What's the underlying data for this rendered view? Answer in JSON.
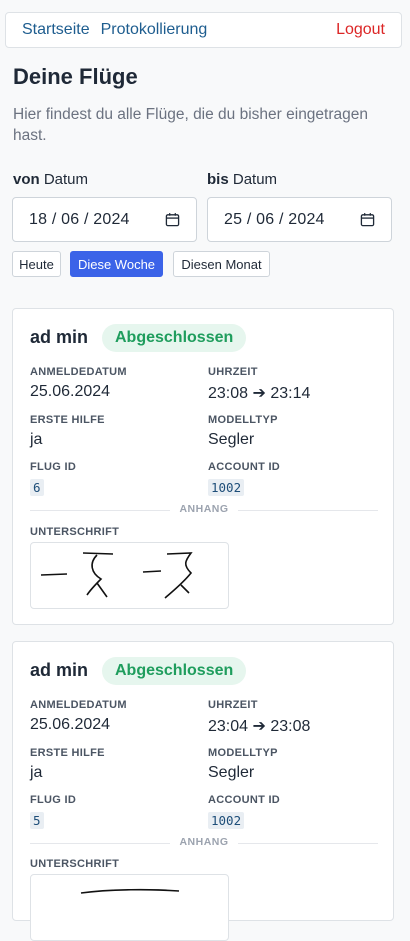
{
  "nav": {
    "home": "Startseite",
    "logging": "Protokollierung",
    "logout": "Logout"
  },
  "page": {
    "title": "Deine Flüge",
    "lead": "Hier findest du alle Flüge, die du bisher eingetragen hast."
  },
  "filter": {
    "from_bold": "von",
    "from_rest": " Datum",
    "to_bold": "bis",
    "to_rest": " Datum",
    "from_value": "18 / 06 / 2024",
    "to_value": "25 / 06 / 2024",
    "quick": [
      "Heute",
      "Diese Woche",
      "Diesen Monat"
    ],
    "active_quick": "Diese Woche"
  },
  "labels": {
    "anmeldedatum": "ANMELDEDATUM",
    "uhrzeit": "UHRZEIT",
    "erste_hilfe": "ERSTE HILFE",
    "modelltyp": "MODELLTYP",
    "flug_id": "FLUG ID",
    "account_id": "ACCOUNT ID",
    "anhang": "ANHANG",
    "unterschrift": "UNTERSCHRIFT"
  },
  "flights": [
    {
      "name": "ad min",
      "status": "Abgeschlossen",
      "date": "25.06.2024",
      "time": "23:08 ➔ 23:14",
      "first_aid": "ja",
      "model": "Segler",
      "flight_id": "6",
      "account_id": "1002"
    },
    {
      "name": "ad min",
      "status": "Abgeschlossen",
      "date": "25.06.2024",
      "time": "23:04 ➔ 23:08",
      "first_aid": "ja",
      "model": "Segler",
      "flight_id": "5",
      "account_id": "1002"
    }
  ],
  "colors": {
    "accent": "#3b63e8",
    "status_green": "#1f9d5d",
    "logout_red": "#dc2626",
    "nav_link": "#1e5d8f"
  }
}
